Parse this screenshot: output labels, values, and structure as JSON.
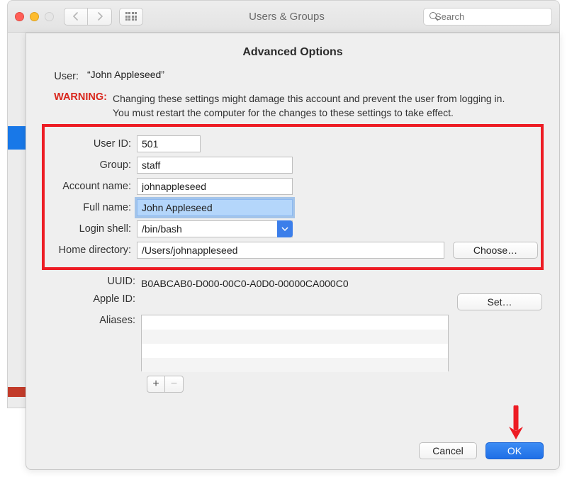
{
  "window": {
    "title": "Users & Groups",
    "search_placeholder": "Search"
  },
  "dialog": {
    "title": "Advanced Options",
    "user_label": "User:",
    "user_value": "“John Appleseed”",
    "warning_label": "WARNING:",
    "warning_text": "Changing these settings might damage this account and prevent the user from logging in. You must restart the computer for the changes to these settings to take effect.",
    "fields": {
      "user_id": {
        "label": "User ID:",
        "value": "501"
      },
      "group": {
        "label": "Group:",
        "value": "staff"
      },
      "account_name": {
        "label": "Account name:",
        "value": "johnappleseed"
      },
      "full_name": {
        "label": "Full name:",
        "value": "John Appleseed"
      },
      "login_shell": {
        "label": "Login shell:",
        "value": "/bin/bash"
      },
      "home_dir": {
        "label": "Home directory:",
        "value": "/Users/johnappleseed",
        "choose": "Choose…"
      }
    },
    "uuid": {
      "label": "UUID:",
      "value": "B0ABCAB0-D000-00C0-A0D0-00000CA000C0"
    },
    "apple_id": {
      "label": "Apple ID:",
      "set": "Set…"
    },
    "aliases": {
      "label": "Aliases:"
    },
    "add_label": "+",
    "remove_label": "−",
    "cancel": "Cancel",
    "ok": "OK"
  }
}
